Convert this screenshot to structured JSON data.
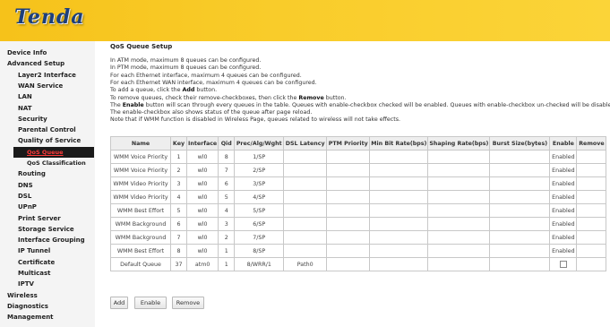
{
  "brand": {
    "logo_text": "Tenda"
  },
  "sidebar": {
    "items": [
      {
        "label": "Device Info",
        "level": 1
      },
      {
        "label": "Advanced Setup",
        "level": 1
      },
      {
        "label": "Layer2 Interface",
        "level": 2
      },
      {
        "label": "WAN Service",
        "level": 2
      },
      {
        "label": "LAN",
        "level": 2
      },
      {
        "label": "NAT",
        "level": 2
      },
      {
        "label": "Security",
        "level": 2
      },
      {
        "label": "Parental Control",
        "level": 2
      },
      {
        "label": "Quality of Service",
        "level": 2
      },
      {
        "label": "QoS Queue",
        "level": 3,
        "active": true
      },
      {
        "label": "QoS Classification",
        "level": 3
      },
      {
        "label": "Routing",
        "level": 2
      },
      {
        "label": "DNS",
        "level": 2
      },
      {
        "label": "DSL",
        "level": 2
      },
      {
        "label": "UPnP",
        "level": 2
      },
      {
        "label": "Print Server",
        "level": 2
      },
      {
        "label": "Storage Service",
        "level": 2
      },
      {
        "label": "Interface Grouping",
        "level": 2
      },
      {
        "label": "IP Tunnel",
        "level": 2
      },
      {
        "label": "Certificate",
        "level": 2
      },
      {
        "label": "Multicast",
        "level": 2
      },
      {
        "label": "IPTV",
        "level": 2
      },
      {
        "label": "Wireless",
        "level": 1
      },
      {
        "label": "Diagnostics",
        "level": 1
      },
      {
        "label": "Management",
        "level": 1
      }
    ]
  },
  "main": {
    "title": "QoS Queue Setup",
    "info": [
      "In ATM mode, maximum 8 queues can be configured.",
      "In PTM mode, maximum 8 queues can be configured.",
      "For each Ethernet interface, maximum 4 queues can be configured.",
      "For each Ethernet WAN interface, maximum 4 queues can be configured.",
      "To add a queue, click the |Add| button.",
      "To remove queues, check their remove-checkboxes, then click the |Remove| button.",
      "The |Enable| button will scan through every queues in the table. Queues with enable-checkbox checked will be enabled. Queues with enable-checkbox un-checked will be disabled.",
      "The enable-checkbox also shows status of the queue after page reload.",
      "Note that if WMM function is disabled in Wireless Page, queues related to wireless will not take effects."
    ],
    "table": {
      "headers": [
        "Name",
        "Key",
        "Interface",
        "Qid",
        "Prec/Alg/Wght",
        "DSL Latency",
        "PTM Priority",
        "Min Bit Rate(bps)",
        "Shaping Rate(bps)",
        "Burst Size(bytes)",
        "Enable",
        "Remove"
      ],
      "rows": [
        [
          "WMM Voice Priority",
          "1",
          "wl0",
          "8",
          "1/SP",
          "",
          "",
          "",
          "",
          "",
          "Enabled",
          ""
        ],
        [
          "WMM Voice Priority",
          "2",
          "wl0",
          "7",
          "2/SP",
          "",
          "",
          "",
          "",
          "",
          "Enabled",
          ""
        ],
        [
          "WMM Video Priority",
          "3",
          "wl0",
          "6",
          "3/SP",
          "",
          "",
          "",
          "",
          "",
          "Enabled",
          ""
        ],
        [
          "WMM Video Priority",
          "4",
          "wl0",
          "5",
          "4/SP",
          "",
          "",
          "",
          "",
          "",
          "Enabled",
          ""
        ],
        [
          "WMM Best Effort",
          "5",
          "wl0",
          "4",
          "5/SP",
          "",
          "",
          "",
          "",
          "",
          "Enabled",
          ""
        ],
        [
          "WMM Background",
          "6",
          "wl0",
          "3",
          "6/SP",
          "",
          "",
          "",
          "",
          "",
          "Enabled",
          ""
        ],
        [
          "WMM Background",
          "7",
          "wl0",
          "2",
          "7/SP",
          "",
          "",
          "",
          "",
          "",
          "Enabled",
          ""
        ],
        [
          "WMM Best Effort",
          "8",
          "wl0",
          "1",
          "8/SP",
          "",
          "",
          "",
          "",
          "",
          "Enabled",
          ""
        ],
        [
          "Default Queue",
          "37",
          "atm0",
          "1",
          "8/WRR/1",
          "Path0",
          "",
          "",
          "",
          "",
          "",
          ""
        ]
      ],
      "last_row_enable_checkbox": false
    },
    "buttons": {
      "add": "Add",
      "enable": "Enable",
      "remove": "Remove"
    }
  },
  "colors": {
    "header_bg": "#f9cc2a",
    "logo": "#1d3f7a",
    "active_text": "#ff3b3b",
    "active_bg": "#1a1a1a"
  }
}
